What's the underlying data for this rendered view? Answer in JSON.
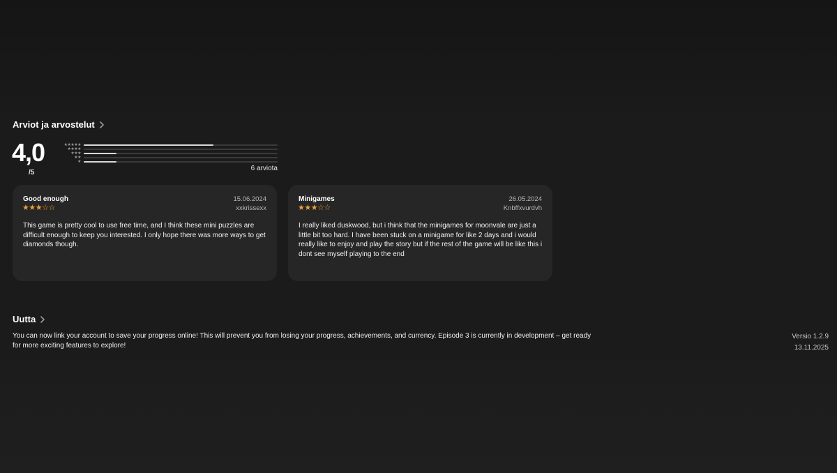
{
  "ratings": {
    "section_title": "Arviot ja arvostelut",
    "average": "4,0",
    "out_of": "/5",
    "histogram": [
      {
        "stars": "★★★★★",
        "fraction": 0.67
      },
      {
        "stars": "★★★★",
        "fraction": 0.0
      },
      {
        "stars": "★★★",
        "fraction": 0.17
      },
      {
        "stars": "★★",
        "fraction": 0.0
      },
      {
        "stars": "★",
        "fraction": 0.17
      }
    ],
    "count_label": "6 arviota"
  },
  "reviews": [
    {
      "title": "Good enough",
      "date": "15.06.2024",
      "author": "xxkrissexx",
      "rating": 3,
      "body": "This game is pretty cool to use free time, and I think these mini puzzles are difficult enough to keep you interested. I only hope there was more ways to get diamonds though."
    },
    {
      "title": "Minigames",
      "date": "26.05.2024",
      "author": "Knbffxvurdvh",
      "rating": 3,
      "body": "I really liked duskwood, but i think that the minigames for moonvale are just a little bit too hard. I have been stuck on a minigame for like 2 days and i would really like to enjoy and play the story but if the rest of the game will be like this i dont see myself playing to the end"
    }
  ],
  "news": {
    "section_title": "Uutta",
    "text": "You can now link your account to save your progress online! This will prevent you from losing your progress, achievements, and currency. Episode 3 is currently in development – get ready for more exciting features to explore!",
    "version": "Versio 1.2.9",
    "date": "13.11.2025"
  },
  "icons": {
    "chevron": "chevron-right-icon",
    "star": "star-icon"
  },
  "colors": {
    "star_accent": "#f0a13b",
    "card_bg": "#262626"
  }
}
